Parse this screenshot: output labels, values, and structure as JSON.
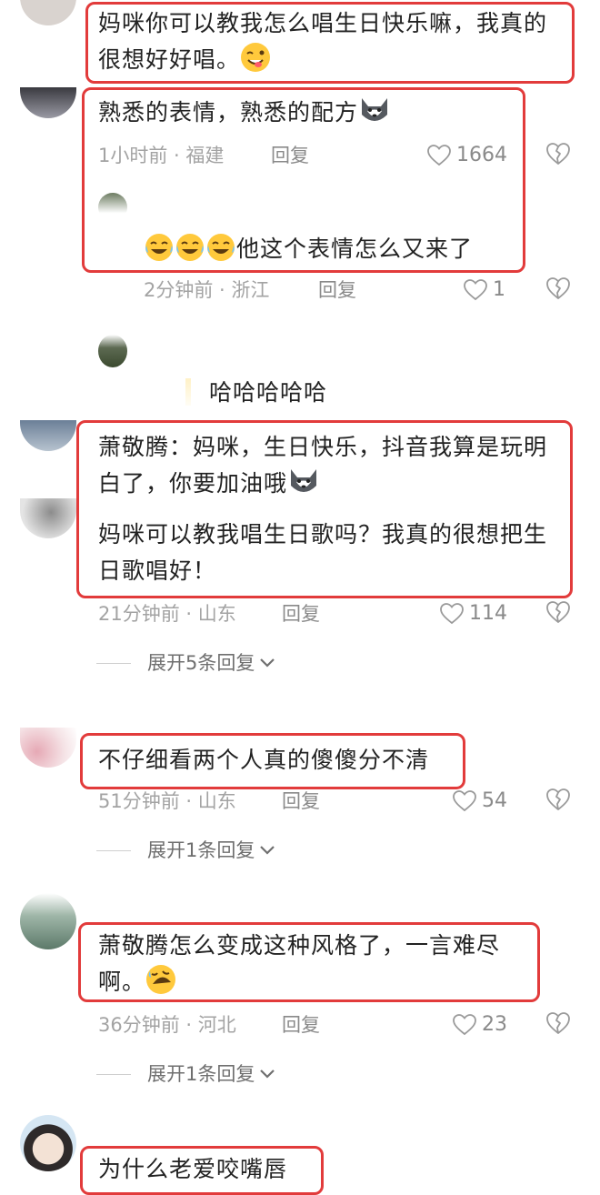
{
  "comments": [
    {
      "text": "妈咪你可以教我怎么唱生日快乐嘛，我真的很想好好唱。"
    },
    {
      "text": "熟悉的表情，熟悉的配方",
      "time": "1小时前",
      "region": "福建",
      "reply": "回复",
      "likes": "1664",
      "sub": {
        "text": "他这个表情怎么又来了",
        "time": "2分钟前",
        "region": "浙江",
        "reply": "回复",
        "likes": "1"
      }
    },
    {
      "sub_text": "哈哈哈哈哈"
    },
    {
      "text1": "萧敬腾：妈咪，生日快乐，抖音我算是玩明白了，你要加油哦",
      "text2": "妈咪可以教我唱生日歌吗？我真的很想把生日歌唱好！",
      "time": "21分钟前",
      "region": "山东",
      "reply": "回复",
      "likes": "114",
      "expand": "展开5条回复"
    },
    {
      "text": "不仔细看两个人真的傻傻分不清",
      "time": "51分钟前",
      "region": "山东",
      "reply": "回复",
      "likes": "54",
      "expand": "展开1条回复"
    },
    {
      "text": "萧敬腾怎么变成这种风格了，一言难尽啊。",
      "time": "36分钟前",
      "region": "河北",
      "reply": "回复",
      "likes": "23",
      "expand": "展开1条回复"
    },
    {
      "text": "为什么老爱咬嘴唇"
    }
  ],
  "meta_separator": " · ",
  "colors": {
    "highlight_border": "#e23b3b",
    "meta": "#a3a3a3"
  }
}
